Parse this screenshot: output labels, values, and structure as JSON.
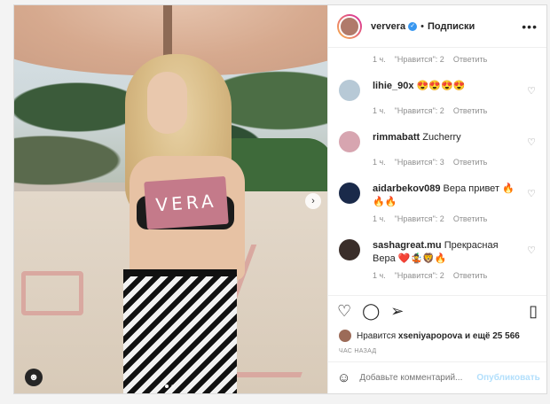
{
  "post": {
    "image_text": "VERA"
  },
  "header": {
    "username": "ververa",
    "separator": "•",
    "follow_label": "Подписки",
    "more_icon": "more-options-icon"
  },
  "comments": [
    {
      "time": "1 ч.",
      "likes": "\"Нравится\": 2",
      "reply": "Ответить"
    },
    {
      "user": "lihie_90x",
      "text": "😍😍😍😍",
      "avatar_color": "#b7c9d6",
      "time": "1 ч.",
      "likes": "\"Нравится\": 2",
      "reply": "Ответить"
    },
    {
      "user": "rimmabatt",
      "text": "Zucherry",
      "avatar_color": "#d7a5b0",
      "time": "1 ч.",
      "likes": "\"Нравится\": 3",
      "reply": "Ответить"
    },
    {
      "user": "aidarbekov089",
      "text": "Вера привет 🔥🔥🔥",
      "avatar_color": "#1a2a4a",
      "time": "1 ч.",
      "likes": "\"Нравится\": 2",
      "reply": "Ответить"
    },
    {
      "user": "sashagreat.mu",
      "text": "Прекрасная Вера ❤️🤹🦁🔥",
      "avatar_color": "#3a2e2a",
      "time": "1 ч.",
      "likes": "\"Нравится\": 2",
      "reply": "Ответить"
    }
  ],
  "likes_line": {
    "prefix": "Нравится",
    "user": "xseniyapopova",
    "suffix": "и ещё 25 566"
  },
  "timestamp": "ЧАС НАЗАД",
  "add_comment": {
    "placeholder": "Добавьте комментарий...",
    "publish": "Опубликовать"
  },
  "colors": {
    "accent": "#3897f0",
    "publish_disabled": "#b2dffc"
  }
}
